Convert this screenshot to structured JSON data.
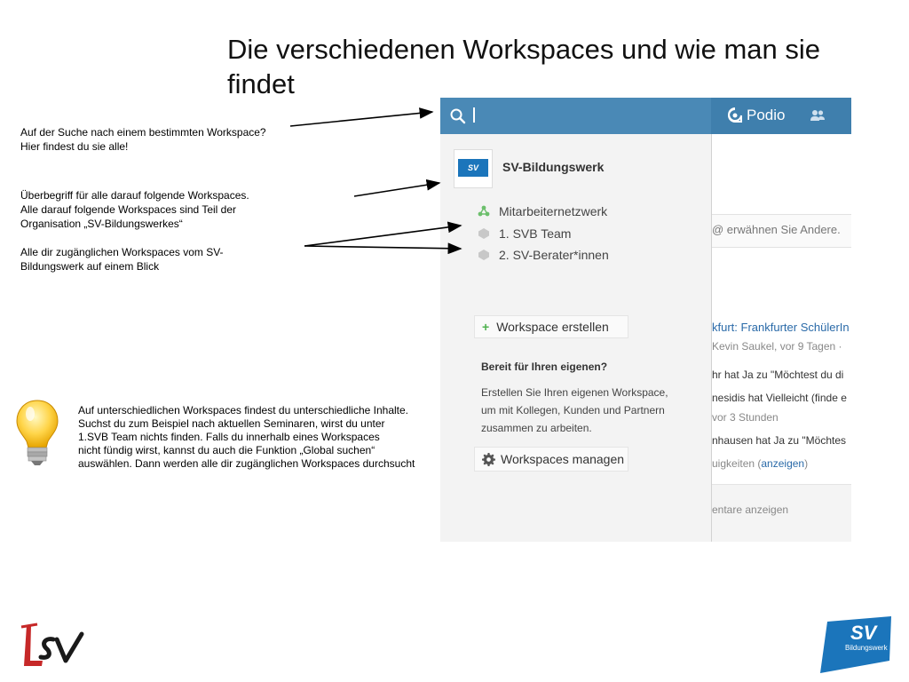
{
  "slide": {
    "title": "Die verschiedenen Workspaces und wie man sie findet",
    "notes": {
      "search": [
        "Auf der Suche nach einem bestimmten Workspace?",
        "Hier findest du sie alle!"
      ],
      "umbrella": [
        "Überbegriff für alle darauf folgende Workspaces.",
        "Alle darauf folgende Workspaces sind Teil der",
        "Organisation „SV-Bildungswerkes“"
      ],
      "accessible": [
        "Alle dir zugänglichen Workspaces vom SV-",
        "Bildungswerk auf einem Blick"
      ],
      "tip": [
        "Auf unterschiedlichen Workspaces findest du unterschiedliche Inhalte.",
        "Suchst du zum Beispiel nach aktuellen Seminaren, wirst du unter",
        "1.SVB Team nichts finden. Falls du innerhalb eines Workspaces",
        "nicht fündig wirst, kannst du auch die Funktion „Global suchen“",
        "auswählen. Dann werden alle dir zugänglichen Workspaces durchsucht"
      ]
    }
  },
  "podio": {
    "brand": "Podio",
    "org": {
      "name": "SV-Bildungswerk",
      "logo_text": "SV"
    },
    "workspaces": [
      {
        "label": "Mitarbeiternetzwerk",
        "icon": "network-icon"
      },
      {
        "label": "1. SVB Team",
        "icon": "workspace-icon"
      },
      {
        "label": "2. SV-Berater*innen",
        "icon": "workspace-icon"
      }
    ],
    "create_label": "Workspace erstellen",
    "create_symbol": "+",
    "ready_title": "Bereit für Ihren eigenen?",
    "ready_text": [
      "Erstellen Sie Ihren eigenen Workspace,",
      "um mit Kollegen, Kunden und Partnern",
      "zusammen zu arbeiten."
    ],
    "manage_label": "Workspaces managen",
    "feed": {
      "mention_placeholder": "@ erwähnen Sie Andere.",
      "link": "kfurt: Frankfurter SchülerIn",
      "meta1": "Kevin Saukel, vor 9 Tagen ·",
      "line1": "hr hat Ja zu \"Möchtest du di",
      "line2": "nesidis hat Vielleicht (finde e",
      "meta2": "vor 3 Stunden",
      "line3": "nhausen hat Ja zu \"Möchtes",
      "updates_text": "uigkeiten (",
      "updates_link": "anzeigen",
      "updates_close": ")",
      "comments": "entare anzeigen"
    }
  },
  "colors": {
    "topbar": "#4a89b6",
    "accent_green": "#4fb14f",
    "link_blue": "#2a6aa8",
    "logo_blue": "#1b75bb"
  },
  "logos": {
    "left": "lsv-logo",
    "right_line1": "SV",
    "right_line2": "Bildungswerk"
  }
}
